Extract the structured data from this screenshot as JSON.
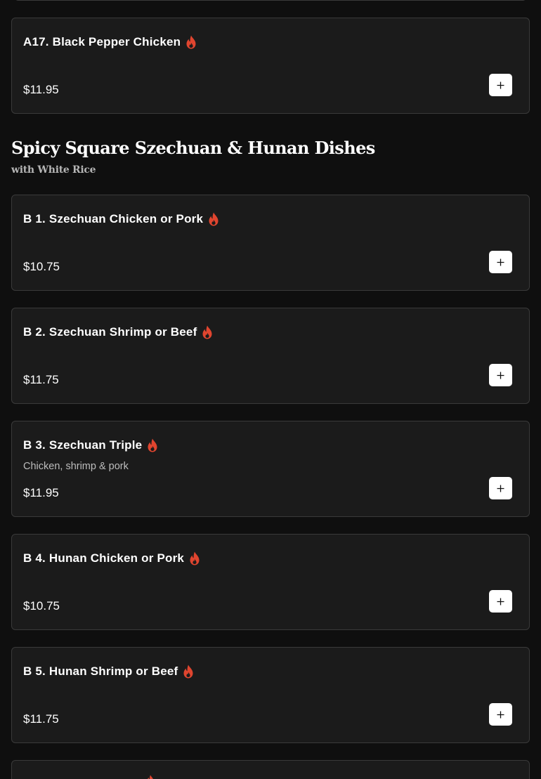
{
  "colors": {
    "background": "#0f0f0f",
    "card": "#1b1b1b",
    "card_border": "#3a3a3a",
    "spicy_flame": "#e0452f",
    "add_button": "#ffffff"
  },
  "icons": {
    "spicy": "flame-icon",
    "add": "plus-icon"
  },
  "section": {
    "title": "Spicy Square Szechuan & Hunan Dishes",
    "subtitle": "with White Rice"
  },
  "items": [
    {
      "name": "A17. Black Pepper Chicken",
      "description": "",
      "price": "$11.95",
      "spicy": true
    },
    {
      "name": "B 1. Szechuan Chicken or Pork",
      "description": "",
      "price": "$10.75",
      "spicy": true
    },
    {
      "name": "B 2. Szechuan Shrimp or Beef",
      "description": "",
      "price": "$11.75",
      "spicy": true
    },
    {
      "name": "B 3. Szechuan Triple",
      "description": "Chicken, shrimp & pork",
      "price": "$11.95",
      "spicy": true
    },
    {
      "name": "B 4. Hunan Chicken or Pork",
      "description": "",
      "price": "$10.75",
      "spicy": true
    },
    {
      "name": "B 5. Hunan Shrimp or Beef",
      "description": "",
      "price": "$11.75",
      "spicy": true
    }
  ]
}
